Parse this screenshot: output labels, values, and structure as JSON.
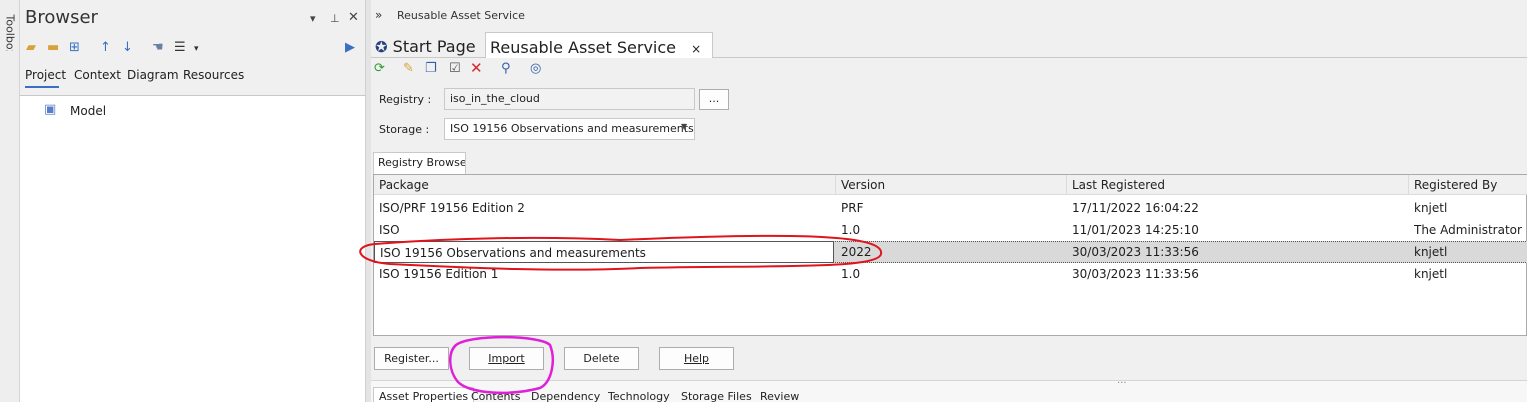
{
  "toolbox": {
    "label": "Toolbox"
  },
  "browser": {
    "title": "Browser",
    "tabs": [
      "Project",
      "Context",
      "Diagram",
      "Resources"
    ],
    "tree_root": "Model"
  },
  "breadcrumb": "Reusable Asset Service",
  "doc_tabs": {
    "start_page": "Start Page",
    "active": "Reusable Asset Service",
    "close": "×"
  },
  "form": {
    "registry_label": "Registry :",
    "registry_value": "iso_in_the_cloud",
    "browse_label": "...",
    "storage_label": "Storage :",
    "storage_value": "ISO 19156 Observations and measurements"
  },
  "registry_tab": "Registry Browser",
  "grid": {
    "columns": [
      "Package",
      "Version",
      "Last Registered",
      "Registered By"
    ],
    "rows": [
      [
        "ISO/PRF 19156 Edition 2",
        "PRF",
        "17/11/2022 16:04:22",
        "knjetl"
      ],
      [
        "ISO",
        "1.0",
        "11/01/2023 14:25:10",
        "The Administrator"
      ],
      [
        "ISO 19156 Observations and measurements",
        "2022",
        "30/03/2023 11:33:56",
        "knjetl"
      ],
      [
        "ISO 19156 Edition 1",
        "1.0",
        "30/03/2023 11:33:56",
        "knjetl"
      ]
    ],
    "selected_row": 2
  },
  "buttons": {
    "register": "Register...",
    "import": "Import",
    "delete": "Delete",
    "help": "Help"
  },
  "bottom_tabs": [
    "Asset Properties",
    "Contents",
    "Dependency",
    "Technology",
    "Storage Files",
    "Review"
  ],
  "grip": "...",
  "colors": {
    "annotation_red": "#e0141c",
    "annotation_magenta": "#e020d8",
    "toolbar_blue": "#3a6fc4"
  }
}
